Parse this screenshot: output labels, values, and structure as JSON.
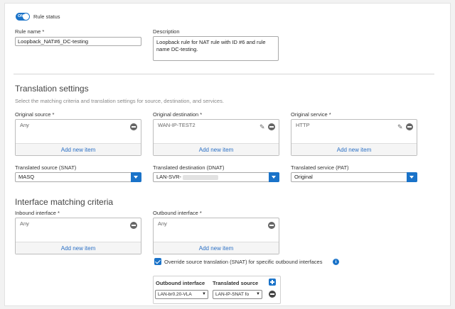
{
  "rule_status": {
    "toggle_text": "ON",
    "label": "Rule status"
  },
  "rule_name": {
    "label": "Rule name *",
    "value": "Loopback_NAT#6_DC-testing"
  },
  "description": {
    "label": "Description",
    "value": "Loopback rule for NAT rule with ID #6 and rule name DC-testing."
  },
  "translation": {
    "title": "Translation settings",
    "subtitle": "Select the matching criteria and translation settings for source, destination, and services.",
    "original_source": {
      "label": "Original source *",
      "value": "Any",
      "add": "Add new item"
    },
    "original_destination": {
      "label": "Original destination *",
      "value": "WAN-IP-TEST2",
      "add": "Add new item"
    },
    "original_service": {
      "label": "Original service *",
      "value": "HTTP",
      "add": "Add new item"
    },
    "translated_source": {
      "label": "Translated source (SNAT)",
      "value": "MASQ"
    },
    "translated_destination": {
      "label": "Translated destination (DNAT)",
      "value": "LAN-SVR-"
    },
    "translated_service": {
      "label": "Translated service (PAT)",
      "value": "Original"
    }
  },
  "interface": {
    "title": "Interface matching criteria",
    "inbound": {
      "label": "Inbound interface *",
      "value": "Any",
      "add": "Add new item"
    },
    "outbound": {
      "label": "Outbound interface *",
      "value": "Any",
      "add": "Add new item"
    },
    "override_label": "Override source translation (SNAT) for specific outbound interfaces",
    "info_glyph": "i",
    "table": {
      "col_outbound": "Outbound interface",
      "col_translated": "Translated source",
      "row": {
        "outbound": "LAN-br0.20-VLA",
        "translated": "LAN-IP-SNAT fo"
      }
    }
  },
  "colors": {
    "accent": "#1a73c9",
    "link": "#2a6fc4"
  }
}
